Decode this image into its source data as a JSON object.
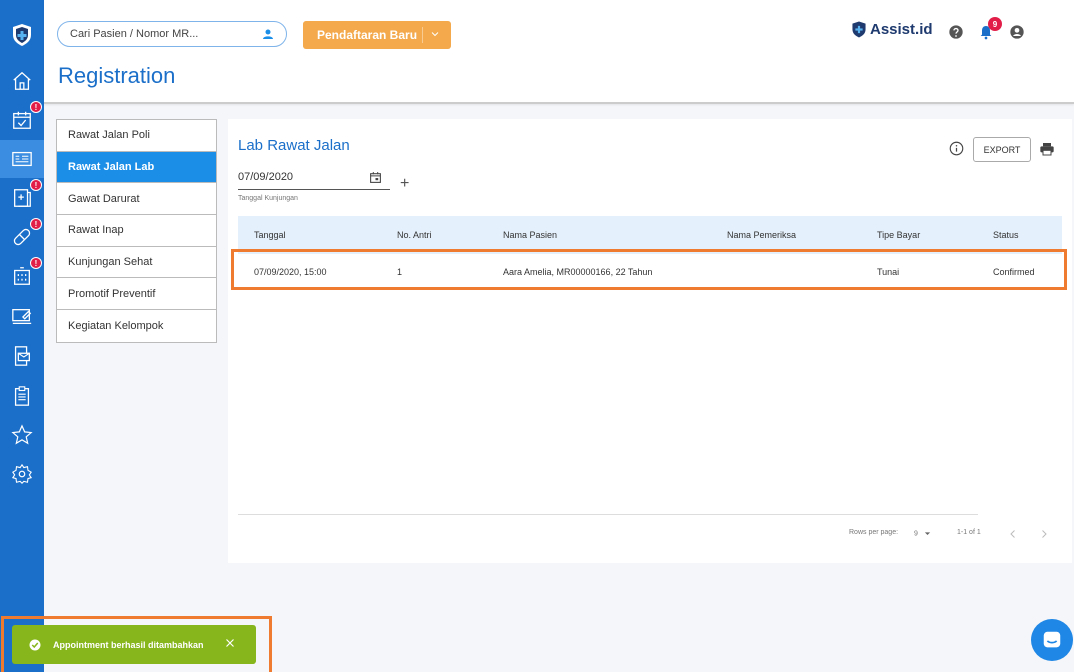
{
  "topbar": {
    "search_placeholder": "Cari Pasien / Nomor MR...",
    "new_registration_label": "Pendaftaran Baru",
    "brand_name": "Assist.id",
    "notification_count": "9"
  },
  "page": {
    "title": "Registration"
  },
  "rail": {
    "items": [
      {
        "icon": "home-icon",
        "badge": false
      },
      {
        "icon": "calendar-check-icon",
        "badge": true
      },
      {
        "icon": "registration-card-icon",
        "badge": false,
        "active": true
      },
      {
        "icon": "medical-folder-icon",
        "badge": true
      },
      {
        "icon": "pill-icon",
        "badge": true
      },
      {
        "icon": "hospital-building-icon",
        "badge": true
      },
      {
        "icon": "monitor-edit-icon",
        "badge": false
      },
      {
        "icon": "mail-device-icon",
        "badge": false
      },
      {
        "icon": "clipboard-list-icon",
        "badge": false
      },
      {
        "icon": "star-icon",
        "badge": false
      },
      {
        "icon": "settings-icon",
        "badge": false
      }
    ],
    "badge_symbol": "!"
  },
  "menu": {
    "items": [
      {
        "label": "Rawat Jalan Poli"
      },
      {
        "label": "Rawat Jalan Lab",
        "active": true
      },
      {
        "label": "Gawat Darurat"
      },
      {
        "label": "Rawat Inap"
      },
      {
        "label": "Kunjungan Sehat"
      },
      {
        "label": "Promotif Preventif"
      },
      {
        "label": "Kegiatan Kelompok"
      }
    ]
  },
  "panel": {
    "title": "Lab Rawat Jalan",
    "export_label": "EXPORT",
    "date_value": "07/09/2020",
    "date_helper": "Tanggal Kunjungan",
    "add_symbol": "+"
  },
  "table": {
    "columns": [
      "Tanggal",
      "No. Antri",
      "Nama Pasien",
      "Nama Pemeriksa",
      "Tipe Bayar",
      "Status"
    ],
    "rows": [
      {
        "tanggal": "07/09/2020, 15:00",
        "no_antri": "1",
        "nama_pasien": "Aara Amelia, MR00000166, 22 Tahun",
        "nama_pemeriksa": "",
        "tipe_bayar": "Tunai",
        "status": "Confirmed"
      }
    ]
  },
  "pagination": {
    "rows_per_page_label": "Rows per page:",
    "rows_per_page_value": "9",
    "range_label": "1-1 of 1"
  },
  "toast": {
    "message": "Appointment berhasil ditambahkan"
  },
  "colors": {
    "primary": "#1b6fc9",
    "accent_orange": "#f3a94c",
    "status_confirmed": "#f0a33d",
    "toast_green": "#86b51c",
    "highlight_outline": "#ef7b31"
  }
}
